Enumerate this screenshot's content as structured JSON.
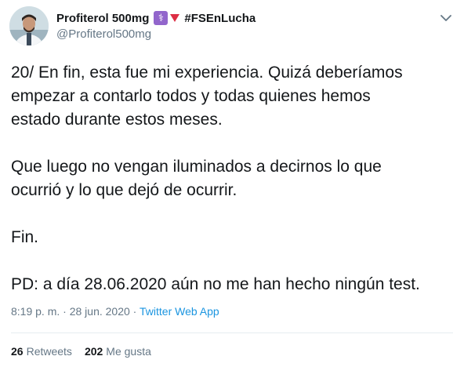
{
  "author": {
    "display_name": "Profiterol 500mg",
    "badge_icon": "medical-symbol-icon",
    "badge_color": "#9266cc",
    "triangle_icon": "red-triangle-down-icon",
    "hashtag": "#FSEnLucha",
    "handle": "@Profiterol500mg"
  },
  "tweet": {
    "paragraph_1": "20/ En fin, esta fue mi experiencia. Quizá deberíamos\nempezar a contarlo todos y todas quienes hemos\nestado durante estos meses.",
    "paragraph_2": "Que luego no vengan iluminados a decirnos lo que\nocurrió y lo que dejó de ocurrir.",
    "paragraph_3": "Fin.",
    "paragraph_4": "PD: a día 28.06.2020 aún no me han hecho ningún test."
  },
  "meta": {
    "time": "8:19 p. m.",
    "separator_1": " · ",
    "date": "28 jun. 2020",
    "separator_2": " · ",
    "source": "Twitter Web App"
  },
  "stats": {
    "retweets_count": "26",
    "retweets_label": "Retweets",
    "likes_count": "202",
    "likes_label": "Me gusta"
  },
  "colors": {
    "link": "#1b95e0",
    "secondary_text": "#657786"
  }
}
